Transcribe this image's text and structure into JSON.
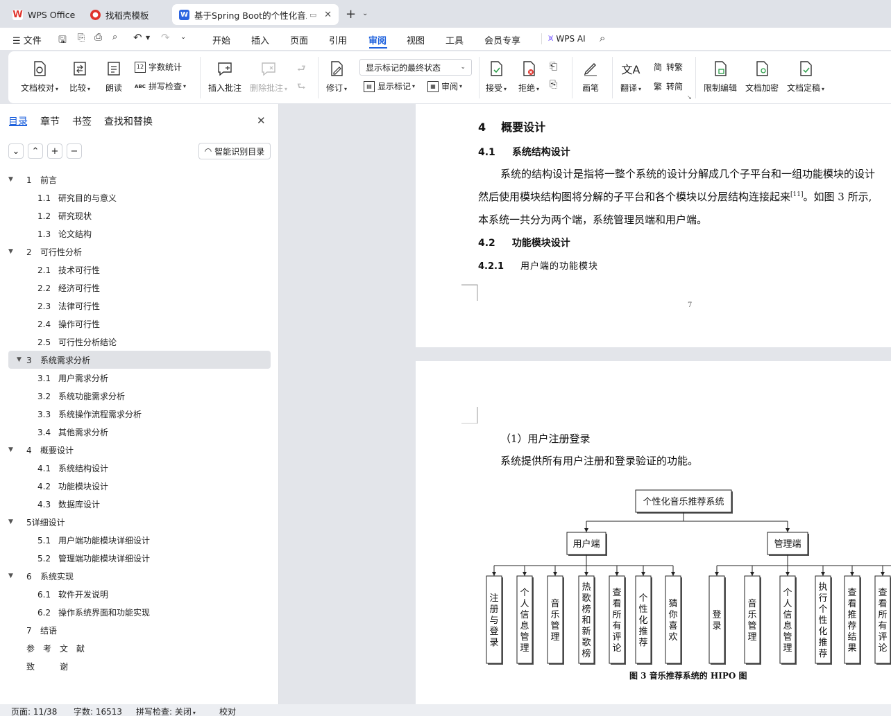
{
  "tabs": {
    "wps": "WPS Office",
    "template": "找稻壳模板",
    "document": "基于Spring Boot的个性化音乐"
  },
  "menu": {
    "file": "文件",
    "items": [
      "开始",
      "插入",
      "页面",
      "引用",
      "审阅",
      "视图",
      "工具",
      "会员专享"
    ],
    "active": "审阅",
    "wps_ai": "WPS AI"
  },
  "ribbon": {
    "doc_check": "文档校对",
    "compare": "比较",
    "read_aloud": "朗读",
    "word_count": "字数统计",
    "spell_check": "拼写检查",
    "insert_comment": "插入批注",
    "delete_comment": "删除批注",
    "track_changes": "修订",
    "markup_state": "显示标记的最终状态",
    "show_markup": "显示标记",
    "review_pane": "审阅",
    "accept": "接受",
    "reject": "拒绝",
    "pen": "画笔",
    "translate": "翻译",
    "to_traditional": "转繁",
    "to_simplified": "转简",
    "restrict_edit": "限制编辑",
    "encrypt": "文档加密",
    "finalize": "文档定稿"
  },
  "sidebar": {
    "tabs": [
      "目录",
      "章节",
      "书签",
      "查找和替换"
    ],
    "smart_toc": "智能识别目录",
    "toc": [
      {
        "num": "1",
        "title": "前言",
        "level": 1
      },
      {
        "num": "1.1",
        "title": "研究目的与意义",
        "level": 2
      },
      {
        "num": "1.2",
        "title": "研究现状",
        "level": 2
      },
      {
        "num": "1.3",
        "title": "论文结构",
        "level": 2
      },
      {
        "num": "2",
        "title": "可行性分析",
        "level": 1
      },
      {
        "num": "2.1",
        "title": "技术可行性",
        "level": 2
      },
      {
        "num": "2.2",
        "title": "经济可行性",
        "level": 2
      },
      {
        "num": "2.3",
        "title": "法律可行性",
        "level": 2
      },
      {
        "num": "2.4",
        "title": "操作可行性",
        "level": 2
      },
      {
        "num": "2.5",
        "title": "可行性分析结论",
        "level": 2
      },
      {
        "num": "3",
        "title": "系统需求分析",
        "level": 1,
        "selected": true
      },
      {
        "num": "3.1",
        "title": "用户需求分析",
        "level": 2
      },
      {
        "num": "3.2",
        "title": "系统功能需求分析",
        "level": 2
      },
      {
        "num": "3.3",
        "title": "系统操作流程需求分析",
        "level": 2
      },
      {
        "num": "3.4",
        "title": "其他需求分析",
        "level": 2
      },
      {
        "num": "4",
        "title": "概要设计",
        "level": 1
      },
      {
        "num": "4.1",
        "title": "系统结构设计",
        "level": 2
      },
      {
        "num": "4.2",
        "title": "功能模块设计",
        "level": 2
      },
      {
        "num": "4.3",
        "title": "数据库设计",
        "level": 2
      },
      {
        "num": "",
        "title": "5详细设计",
        "level": 1
      },
      {
        "num": "5.1",
        "title": "用户端功能模块详细设计",
        "level": 2
      },
      {
        "num": "5.2",
        "title": "管理端功能模块详细设计",
        "level": 2
      },
      {
        "num": "6",
        "title": "系统实现",
        "level": 1
      },
      {
        "num": "6.1",
        "title": "软件开发说明",
        "level": 2
      },
      {
        "num": "6.2",
        "title": "操作系统界面和功能实现",
        "level": 2
      },
      {
        "num": "7",
        "title": "结语",
        "level": 0
      },
      {
        "num": "",
        "title": "参　考　文　献",
        "level": 0
      },
      {
        "num": "",
        "title": "致　　　谢",
        "level": 0
      }
    ]
  },
  "document": {
    "h1_num": "4",
    "h1": "概要设计",
    "h2a_num": "4.1",
    "h2a": "系统结构设计",
    "p1": "系统的结构设计是指将一整个系统的设计分解成几个子平台和一组功能模块的设计",
    "p2a": "然后使用模块结构图将分解的子平台和各个模块以分层结构连接起来",
    "p2_ref": "[11]",
    "p2b": "。如图 3 所示,",
    "p3": "本系统一共分为两个端，系统管理员端和用户端。",
    "h2b_num": "4.2",
    "h2b": "功能模块设计",
    "h3_num": "4.2.1",
    "h3": "用户端的功能模块",
    "page_number": "7",
    "p4": "（1）用户注册登录",
    "p5": "系统提供所有用户注册和登录验证的功能。",
    "figure": {
      "root": "个性化音乐推荐系统",
      "user": "用户端",
      "admin": "管理端",
      "user_leaves": [
        "注册与登录",
        "个人信息管理",
        "音乐管理",
        "热歌榜和新歌榜",
        "查看所有评论",
        "个性化推荐",
        "猜你喜欢"
      ],
      "admin_leaves": [
        "登录",
        "音乐管理",
        "个人信息管理",
        "执行个性化推荐",
        "查看推荐结果",
        "查看所有评论"
      ],
      "caption": "图 3  音乐推荐系统的 HIPO 图"
    }
  },
  "status": {
    "page": "页面: 11/38",
    "words": "字数: 16513",
    "spell": "拼写检查: 关闭",
    "proof": "校对"
  },
  "colors": {
    "accent": "#1f62dd",
    "wps_red": "#e0332b",
    "doc_blue": "#2b63e0"
  }
}
